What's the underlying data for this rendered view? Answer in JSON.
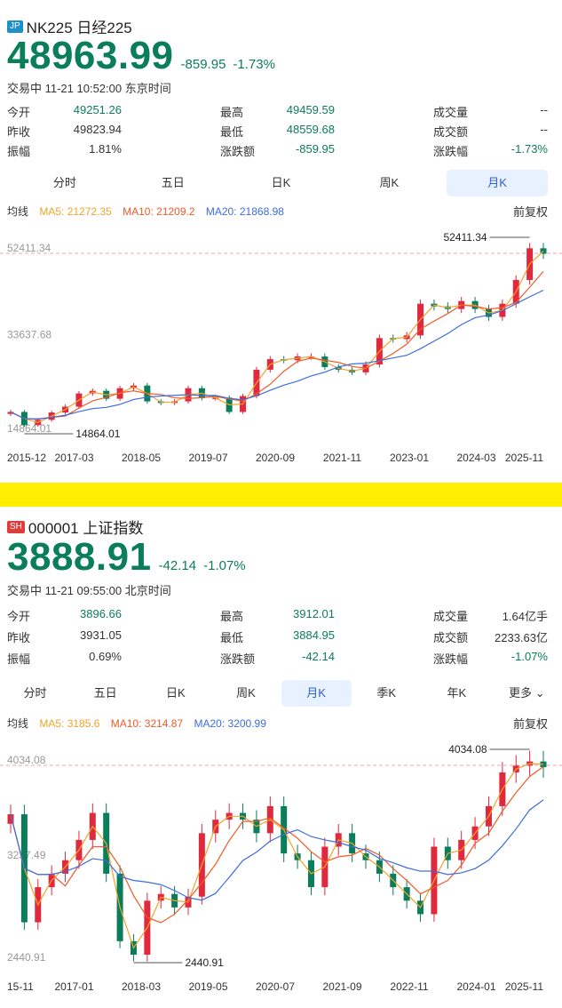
{
  "panels": [
    {
      "flag": "JP",
      "flag_color": "#1f8fc9",
      "name": "NK225 日经225",
      "price": "48963.99",
      "change": "-859.95",
      "change_pct": "-1.73%",
      "status": "交易中 11-21 10:52:00 东京时间",
      "stats": [
        [
          "今开",
          "49251.26",
          "最高",
          "49459.59",
          "成交量",
          "--"
        ],
        [
          "昨收",
          "49823.94",
          "最低",
          "48559.68",
          "成交额",
          "--"
        ],
        [
          "振幅",
          "1.81%",
          "涨跌额",
          "-859.95",
          "涨跌幅",
          "-1.73%"
        ]
      ],
      "tabs": [
        "分时",
        "五日",
        "日K",
        "周K",
        "月K"
      ],
      "active_tab": "月K",
      "ma_label": "均线",
      "ma5": "MA5: 21272.35",
      "ma10": "MA10: 21209.2",
      "ma20": "MA20: 21868.98",
      "adjust": "前复权",
      "ytick_top": "52411.34",
      "ytick_mid": "33637.68",
      "ytick_low": "14864.01",
      "max_label": "52411.34",
      "min_label": "14864.01",
      "xticks": [
        "2015-12",
        "2017-03",
        "2018-05",
        "2019-07",
        "2020-09",
        "2021-11",
        "2023-01",
        "2024-03",
        "2025-11"
      ]
    },
    {
      "flag": "SH",
      "flag_color": "#e03c3c",
      "name": "000001 上证指数",
      "price": "3888.91",
      "change": "-42.14",
      "change_pct": "-1.07%",
      "status": "交易中 11-21 09:55:00 北京时间",
      "stats": [
        [
          "今开",
          "3896.66",
          "最高",
          "3912.01",
          "成交量",
          "1.64亿手"
        ],
        [
          "昨收",
          "3931.05",
          "最低",
          "3884.95",
          "成交额",
          "2233.63亿"
        ],
        [
          "振幅",
          "0.69%",
          "涨跌额",
          "-42.14",
          "涨跌幅",
          "-1.07%"
        ]
      ],
      "tabs": [
        "分时",
        "五日",
        "日K",
        "周K",
        "月K",
        "季K",
        "年K",
        "更多"
      ],
      "active_tab": "月K",
      "ma_label": "均线",
      "ma5": "MA5: 3185.6",
      "ma10": "MA10: 3214.87",
      "ma20": "MA20: 3200.99",
      "adjust": "前复权",
      "ytick_top": "4034.08",
      "ytick_mid": "3237.49",
      "ytick_low": "2440.91",
      "max_label": "4034.08",
      "min_label": "2440.91",
      "xticks": [
        "15-11",
        "2017-01",
        "2018-03",
        "2019-05",
        "2020-07",
        "2021-09",
        "2022-11",
        "2024-01",
        "2025-11"
      ]
    }
  ],
  "colors": {
    "up": "#e0293d",
    "down": "#0a7d5a",
    "ma5": "#f2a22c",
    "ma10": "#f05a28",
    "ma20": "#3d6ddf",
    "refline": "#f2a6a6"
  },
  "chart_data": [
    {
      "type": "candlestick",
      "title": "NK225 日经225 月K",
      "ylim": [
        14864.01,
        52411.34
      ],
      "x_range": [
        "2015-12",
        "2025-11"
      ],
      "close_approx": [
        19000,
        16500,
        17500,
        18900,
        20000,
        22500,
        23000,
        21500,
        23500,
        24000,
        21000,
        20700,
        21000,
        23500,
        21600,
        21700,
        19000,
        22000,
        27000,
        29000,
        28800,
        29500,
        29500,
        27500,
        27000,
        26500,
        28000,
        33000,
        32800,
        33500,
        39500,
        39000,
        38500,
        40000,
        38500,
        37000,
        39500,
        44000,
        50000,
        48963.99
      ]
    },
    {
      "type": "candlestick",
      "title": "000001 上证指数 月K",
      "ylim": [
        2440.91,
        4034.08
      ],
      "x_range": [
        "2015-11",
        "2025-11"
      ],
      "close_approx": [
        3540,
        2740,
        3000,
        3100,
        3200,
        3350,
        3550,
        3100,
        2600,
        2500,
        2900,
        2950,
        2850,
        2930,
        3400,
        3500,
        3550,
        3500,
        3400,
        3600,
        3250,
        3200,
        3000,
        3300,
        3400,
        3250,
        3200,
        3100,
        3000,
        2900,
        2800,
        3300,
        3200,
        3350,
        3450,
        3600,
        3850,
        3900,
        3931.05,
        3888.91
      ]
    }
  ]
}
